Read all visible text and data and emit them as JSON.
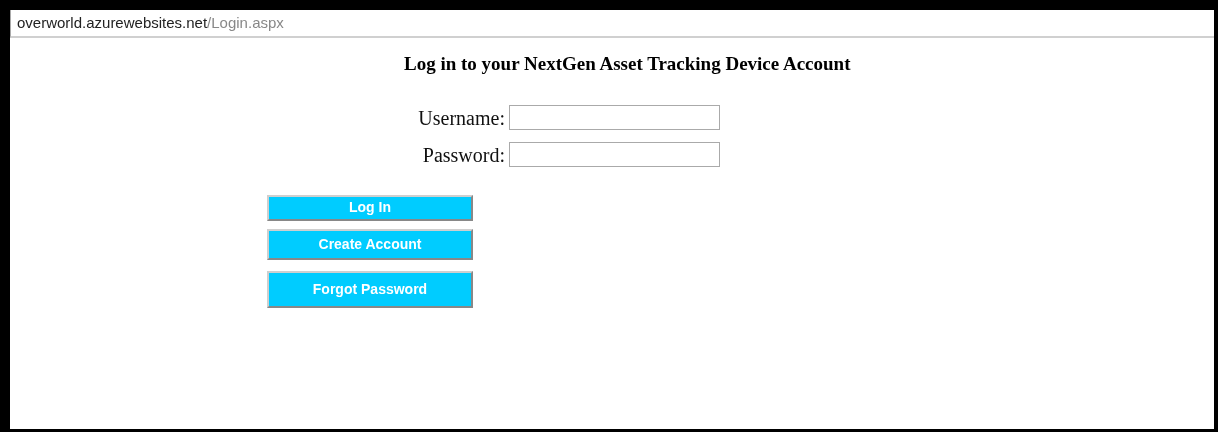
{
  "address_bar": {
    "host": "overworld.azurewebsites.net",
    "path": "/Login.aspx"
  },
  "heading": "Log in to your NextGen Asset Tracking Device Account",
  "fields": [
    {
      "label": "Username:"
    },
    {
      "label": "Password:"
    }
  ],
  "buttons": [
    "Log In",
    "Create Account",
    "Forgot Password"
  ]
}
